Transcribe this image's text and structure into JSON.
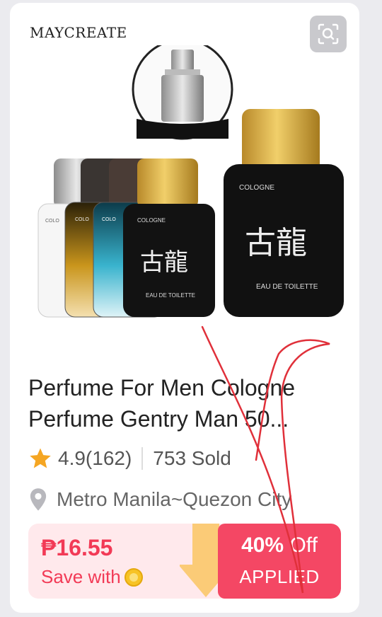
{
  "product": {
    "brand": "MAYCREATE",
    "title": "Perfume For Men Cologne Perfume Gentry Man 50...",
    "rating": "4.9(162)",
    "sold": "753 Sold",
    "location": "Metro Manila~Quezon City"
  },
  "bottle_labels": {
    "cologne": "COLOGNE",
    "eau_de_toilette": "EAU DE TOILETTE",
    "small_label": "COLO",
    "glyph": "古龍"
  },
  "promo": {
    "price": "₱16.55",
    "save_text": "Save with",
    "discount_pct": "40%",
    "discount_word": "Off",
    "applied": "APPLIED"
  },
  "colors": {
    "accent": "#f23a56",
    "discount_bg": "#f44764",
    "promo_bg": "#ffe9ec",
    "star": "#f5a623",
    "scribble": "#e0303a"
  },
  "icons": [
    "image-search-icon",
    "star-icon",
    "location-pin-icon",
    "coin-icon",
    "down-arrow-icon"
  ]
}
